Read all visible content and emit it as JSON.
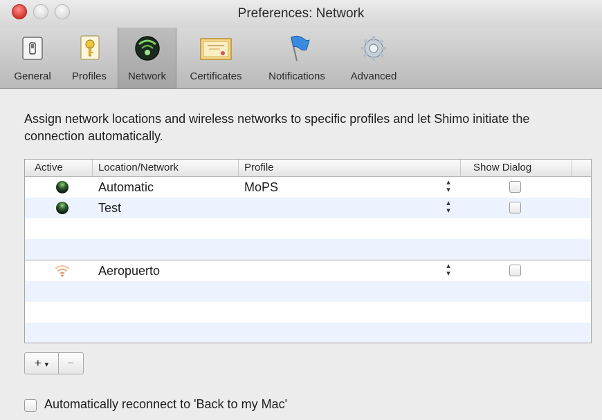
{
  "window": {
    "title": "Preferences: Network"
  },
  "toolbar": {
    "items": [
      {
        "label": "General",
        "icon": "general-icon"
      },
      {
        "label": "Profiles",
        "icon": "profiles-icon"
      },
      {
        "label": "Network",
        "icon": "network-icon",
        "selected": true
      },
      {
        "label": "Certificates",
        "icon": "certificates-icon"
      },
      {
        "label": "Notifications",
        "icon": "notifications-icon"
      },
      {
        "label": "Advanced",
        "icon": "advanced-icon"
      }
    ]
  },
  "main": {
    "description": "Assign network locations and wireless networks to specific profiles and let Shimo initiate the connection automatically.",
    "table": {
      "columns": [
        "Active",
        "Location/Network",
        "Profile",
        "Show Dialog"
      ],
      "rows": [
        {
          "icon": "location-icon",
          "location": "Automatic",
          "profile": "MoPS",
          "show_dialog": false
        },
        {
          "icon": "location-icon",
          "location": "Test",
          "profile": "",
          "show_dialog": false
        },
        {
          "icon": "wifi-icon",
          "location": "Aeropuerto",
          "profile": "",
          "show_dialog": false
        }
      ]
    },
    "buttons": {
      "add": "+",
      "add_menu": "▾",
      "remove": "−"
    },
    "reconnect": {
      "label": "Automatically reconnect to 'Back to my Mac'",
      "checked": false
    }
  },
  "colors": {
    "close": "#d2352c",
    "row_alt": "#edf3fe",
    "selected_tab": "#a4a4a4"
  }
}
